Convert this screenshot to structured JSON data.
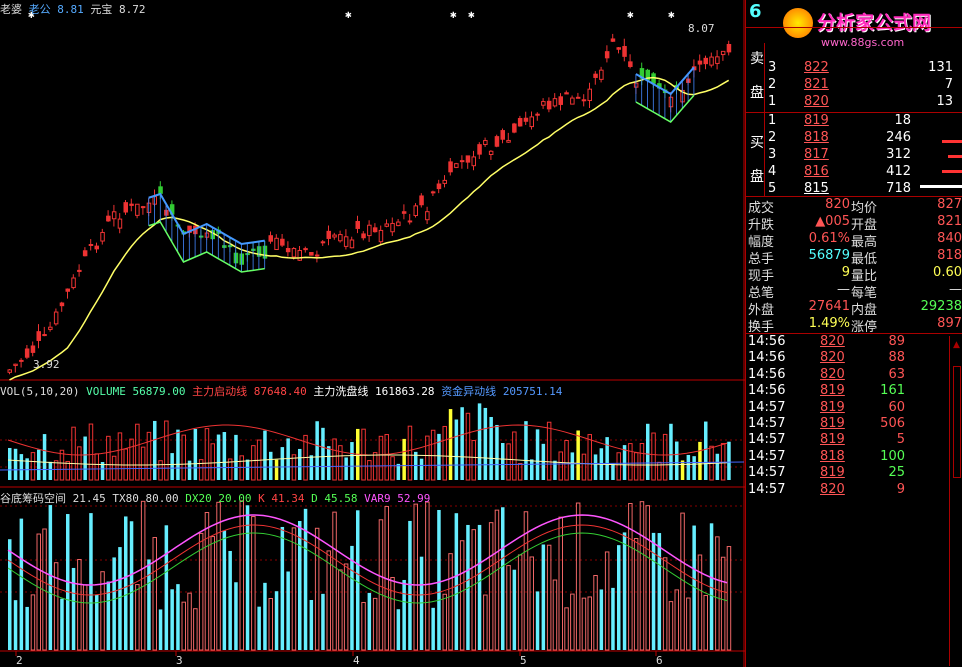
{
  "top_bar": {
    "lines": [
      {
        "label": "老婆",
        "color": "#dddddd"
      },
      {
        "label": "老公",
        "value": "8.81",
        "color": "#55aaff"
      },
      {
        "label": "元宝",
        "value": "8.72",
        "color": "#dddddd"
      }
    ],
    "price_high_label": "8.07",
    "price_low_label": "3.92"
  },
  "volume_panel": {
    "title": "VOL(5,10,20)",
    "items": [
      {
        "label": "VOLUME",
        "value": "56879.00",
        "color": "#55ffaa"
      },
      {
        "label": "主力启动线",
        "value": "87648.40",
        "color": "#ff4444"
      },
      {
        "label": "主力洗盘线",
        "value": "161863.28",
        "color": "#ffffff"
      },
      {
        "label": "资金异动线",
        "value": "205751.14",
        "color": "#5599ff"
      }
    ]
  },
  "indicator_panel": {
    "title": "谷底筹码空间",
    "items": [
      {
        "label": "21.45",
        "color": "#dddddd"
      },
      {
        "label": "TX80",
        "value": "80.00",
        "color": "#dddddd"
      },
      {
        "label": "DX20",
        "value": "20.00",
        "color": "#55ff55"
      },
      {
        "label": "K",
        "value": "41.34",
        "color": "#ff4444"
      },
      {
        "label": "D",
        "value": "45.58",
        "color": "#55ff55"
      },
      {
        "label": "VAR9",
        "value": "52.99",
        "color": "#ff55ff"
      }
    ]
  },
  "x_axis_labels": [
    "2",
    "3",
    "4",
    "5",
    "6"
  ],
  "watermark": {
    "title": "分析家公式网",
    "url": "www.88gs.com"
  },
  "side_panel": {
    "sell_label": [
      "卖",
      "盘"
    ],
    "buy_label": [
      "买",
      "盘"
    ],
    "top_number": "6",
    "sell_rows": [
      {
        "level": "3",
        "price": "822",
        "vol": "131"
      },
      {
        "level": "2",
        "price": "821",
        "vol": "7"
      },
      {
        "level": "1",
        "price": "820",
        "vol": "13"
      }
    ],
    "buy_rows": [
      {
        "level": "1",
        "price": "819",
        "vol": "18"
      },
      {
        "level": "2",
        "price": "818",
        "vol": "246"
      },
      {
        "level": "3",
        "price": "817",
        "vol": "312"
      },
      {
        "level": "4",
        "price": "816",
        "vol": "412"
      },
      {
        "level": "5",
        "price": "815",
        "vol": "718"
      }
    ],
    "stats": [
      {
        "l1": "成交",
        "v1": "820",
        "c1": "#ff5555",
        "l2": "均价",
        "v2": "827",
        "c2": "#ff5555"
      },
      {
        "l1": "升跌",
        "v1": "▲005",
        "c1": "#ff5555",
        "l2": "开盘",
        "v2": "821",
        "c2": "#ff5555"
      },
      {
        "l1": "幅度",
        "v1": "0.61%",
        "c1": "#ff5555",
        "l2": "最高",
        "v2": "840",
        "c2": "#ff5555"
      },
      {
        "l1": "总手",
        "v1": "56879",
        "c1": "#55ffff",
        "l2": "最低",
        "v2": "818",
        "c2": "#ff5555"
      },
      {
        "l1": "现手",
        "v1": "9",
        "c1": "#ffff55",
        "l2": "量比",
        "v2": "0.60",
        "c2": "#ffff55"
      },
      {
        "l1": "总笔",
        "v1": "—",
        "c1": "#dddddd",
        "l2": "每笔",
        "v2": "—",
        "c2": "#dddddd"
      },
      {
        "l1": "外盘",
        "v1": "27641",
        "c1": "#ff5555",
        "l2": "内盘",
        "v2": "29238",
        "c2": "#55ff55"
      },
      {
        "l1": "换手",
        "v1": "1.49%",
        "c1": "#ffff55",
        "l2": "涨停",
        "v2": "897",
        "c2": "#ff5555"
      }
    ],
    "ticks": [
      {
        "time": "14:56",
        "price": "820",
        "vol": "89",
        "c": "#ff5555"
      },
      {
        "time": "14:56",
        "price": "820",
        "vol": "88",
        "c": "#ff5555"
      },
      {
        "time": "14:56",
        "price": "820",
        "vol": "63",
        "c": "#ff5555"
      },
      {
        "time": "14:56",
        "price": "819",
        "vol": "161",
        "c": "#55ff55"
      },
      {
        "time": "14:57",
        "price": "819",
        "vol": "60",
        "c": "#ff5555"
      },
      {
        "time": "14:57",
        "price": "819",
        "vol": "506",
        "c": "#ff5555"
      },
      {
        "time": "14:57",
        "price": "819",
        "vol": "5",
        "c": "#ff5555"
      },
      {
        "time": "14:57",
        "price": "818",
        "vol": "100",
        "c": "#55ff55"
      },
      {
        "time": "14:57",
        "price": "819",
        "vol": "25",
        "c": "#55ff55"
      },
      {
        "time": "14:57",
        "price": "820",
        "vol": "9",
        "c": "#ff5555"
      }
    ]
  }
}
